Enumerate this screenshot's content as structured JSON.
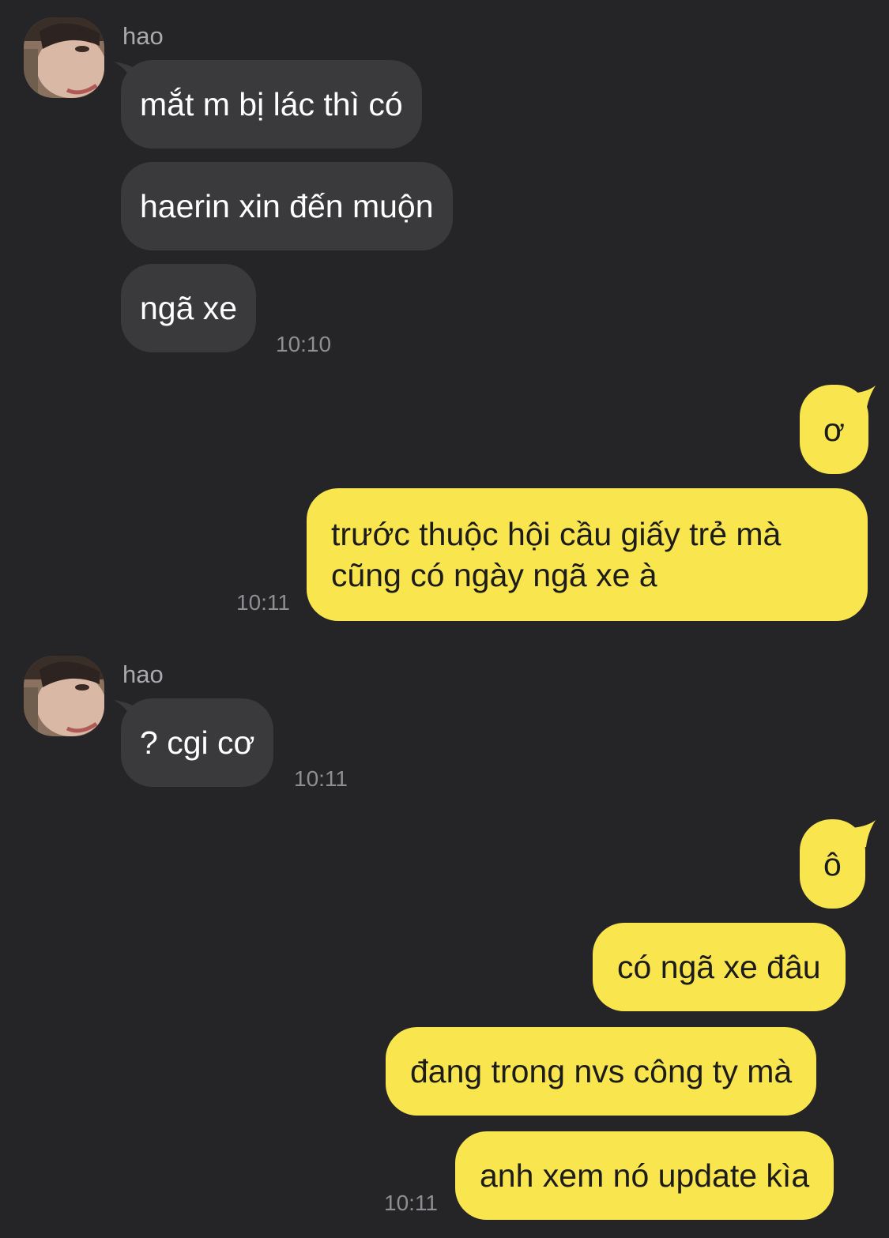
{
  "contact": {
    "name": "hao"
  },
  "colors": {
    "background": "#252527",
    "incoming_bubble": "#3a3a3d",
    "outgoing_bubble": "#f9e54d"
  },
  "messages": [
    {
      "sender": "hao",
      "direction": "incoming",
      "text": "mắt m bị lác thì có"
    },
    {
      "sender": "hao",
      "direction": "incoming",
      "text": "haerin xin đến muộn"
    },
    {
      "sender": "hao",
      "direction": "incoming",
      "text": "ngã xe",
      "time": "10:10"
    },
    {
      "sender": "me",
      "direction": "outgoing",
      "text": "ơ"
    },
    {
      "sender": "me",
      "direction": "outgoing",
      "text": "trước thuộc hội cầu giấy trẻ mà cũng có ngày ngã xe à",
      "time": "10:11"
    },
    {
      "sender": "hao",
      "direction": "incoming",
      "text": "? cgi cơ",
      "time": "10:11"
    },
    {
      "sender": "me",
      "direction": "outgoing",
      "text": "ô"
    },
    {
      "sender": "me",
      "direction": "outgoing",
      "text": "có ngã xe đâu"
    },
    {
      "sender": "me",
      "direction": "outgoing",
      "text": "đang trong nvs công ty mà"
    },
    {
      "sender": "me",
      "direction": "outgoing",
      "text": "anh xem nó update kìa",
      "time": "10:11"
    }
  ]
}
